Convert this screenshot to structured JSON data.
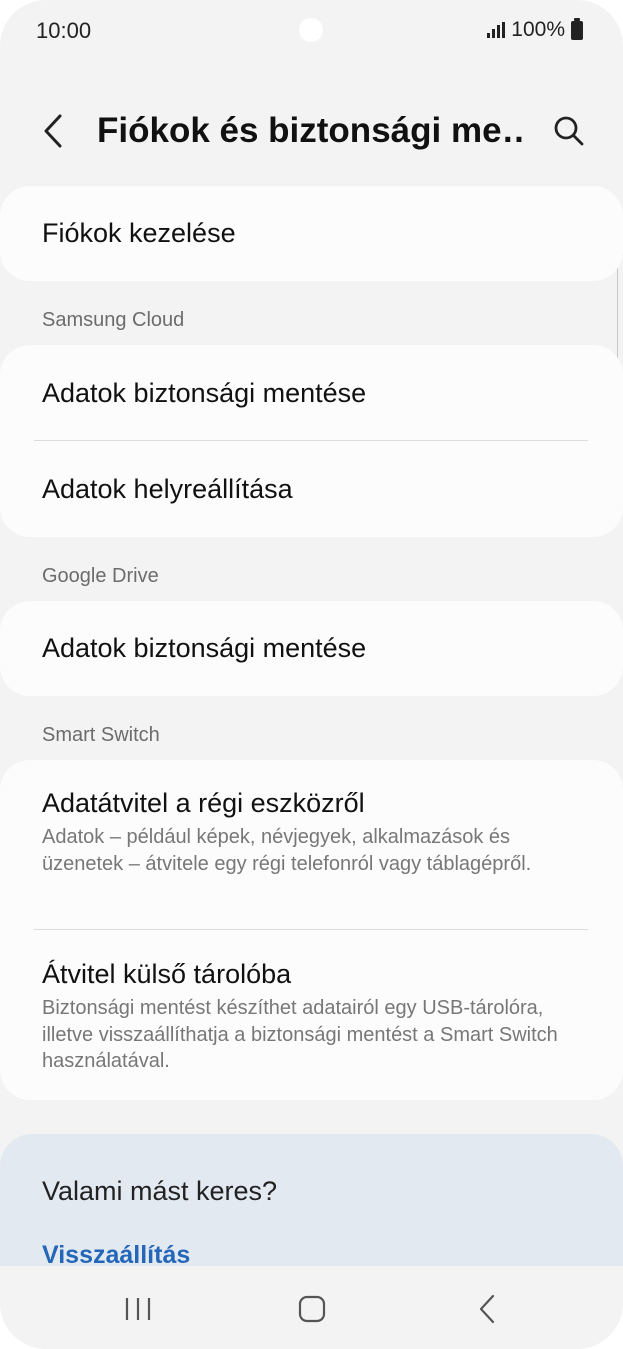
{
  "status_bar": {
    "time": "10:00",
    "battery_text": "100%"
  },
  "header": {
    "title": "Fiókok és biztonsági me…",
    "back_icon": "chevron-left-icon",
    "search_icon": "search-icon"
  },
  "manage_accounts": {
    "label": "Fiókok kezelése"
  },
  "samsung_cloud": {
    "header": "Samsung Cloud",
    "items": [
      {
        "label": "Adatok biztonsági mentése"
      },
      {
        "label": "Adatok helyreállítása"
      }
    ]
  },
  "google_drive": {
    "header": "Google Drive",
    "items": [
      {
        "label": "Adatok biztonsági mentése"
      }
    ]
  },
  "smart_switch": {
    "header": "Smart Switch",
    "items": [
      {
        "label": "Adatátvitel a régi eszközről",
        "description": "Adatok – például képek, névjegyek, alkalmazások és üzenetek – átvitele egy régi telefonról vagy táblagépről."
      },
      {
        "label": "Átvitel külső tárolóba",
        "description": "Biztonsági mentést készíthet adatairól egy USB-tárolóra, illetve visszaállíthatja a biztonsági mentést a Smart Switch használatával."
      }
    ]
  },
  "suggestions": {
    "title": "Valami mást keres?",
    "link": "Visszaállítás"
  },
  "nav_bar": {
    "recents_icon": "recents-icon",
    "home_icon": "home-icon",
    "back_icon": "back-icon"
  },
  "colors": {
    "background": "#f3f3f3",
    "card": "#fcfcfc",
    "suggestion_card": "#e3e9f1",
    "link": "#2467b8"
  }
}
